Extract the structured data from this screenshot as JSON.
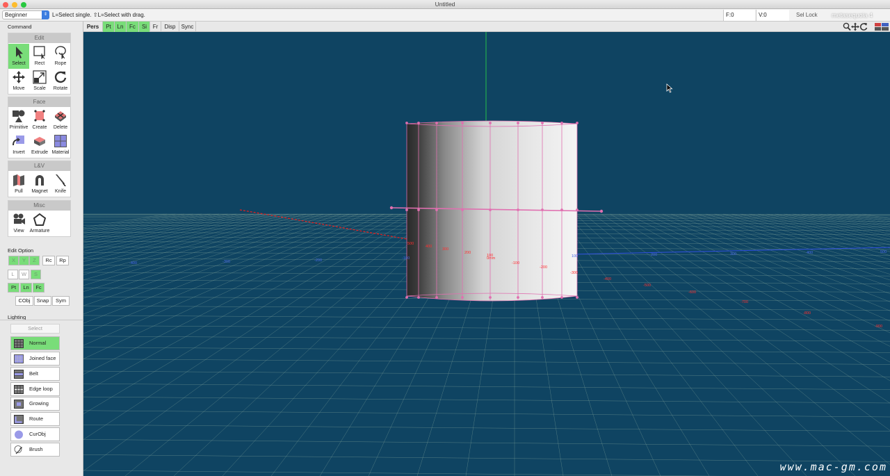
{
  "window": {
    "title": "Untitled",
    "colors": {
      "close": "#fc5f57",
      "minimize": "#fdbc2e",
      "maximize": "#28c840"
    }
  },
  "infobar": {
    "mode": "Beginner",
    "hint": "L=Select single.  ⇧L=Select with drag.",
    "faces": "F:0",
    "vertices": "V:0",
    "sel_lock": "Sel Lock",
    "app_label": "metasequoia 4"
  },
  "sidebar": {
    "command_label": "Command",
    "groups": {
      "edit": {
        "title": "Edit",
        "tools": [
          "Select",
          "Rect",
          "Rope",
          "Move",
          "Scale",
          "Rotate"
        ]
      },
      "face": {
        "title": "Face",
        "tools": [
          "Primitive",
          "Create",
          "Delete",
          "Invert",
          "Extrude",
          "Material"
        ]
      },
      "lv": {
        "title": "L&V",
        "tools": [
          "Pull",
          "Magnet",
          "Knife"
        ]
      },
      "misc": {
        "title": "Misc",
        "tools": [
          "View",
          "Armature"
        ]
      }
    },
    "active_tool": "Select",
    "edit_option": {
      "label": "Edit Option",
      "axes": [
        "X",
        "Y",
        "Z"
      ],
      "rc": "Rc",
      "rp": "Rp",
      "lws": [
        "L",
        "W",
        "S"
      ],
      "types": [
        "Pt",
        "Ln",
        "Fc"
      ],
      "cobj": "CObj",
      "snap": "Snap",
      "sym": "Sym"
    },
    "lighting": {
      "label": "Lighting",
      "select": "Select",
      "items": [
        "Normal",
        "Joined face",
        "Belt",
        "Edge loop",
        "Growing",
        "Route",
        "CurObj",
        "Brush"
      ],
      "active": "Normal"
    }
  },
  "viewbar": {
    "view_name": "Pers",
    "buttons": [
      "Pt",
      "Ln",
      "Fc",
      "Si",
      "Fr",
      "Disp",
      "Sync"
    ],
    "active": [
      "Pt",
      "Ln",
      "Fc",
      "Si"
    ]
  },
  "viewport": {
    "background": "#0f4462",
    "x_labels_red": [
      "500",
      "400",
      "300",
      "200",
      "100",
      "0mm",
      "-100",
      "-200",
      "-300",
      "-400",
      "-500",
      "-600",
      "-700",
      "-800",
      "-900"
    ],
    "z_labels_blue": [
      "-400",
      "-300",
      "-200",
      "-100",
      "100",
      "200",
      "300",
      "400",
      "500"
    ],
    "grid_color": "#8fb0a0"
  },
  "watermark": "www.mac-gm.com"
}
